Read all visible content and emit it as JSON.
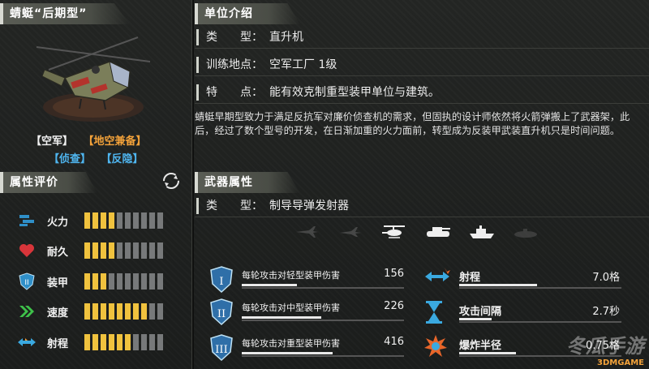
{
  "unit": {
    "name": "蜻蜓“后期型”",
    "tags_row1": [
      {
        "label": "【空军】",
        "color": "white"
      },
      {
        "label": "【地空兼备】",
        "color": "orange"
      }
    ],
    "tags_row2": [
      {
        "label": "【侦查】",
        "color": "blue"
      },
      {
        "label": "【反隐】",
        "color": "blue"
      }
    ]
  },
  "attributes": {
    "header": "属性评价",
    "items": [
      {
        "name": "火力",
        "icon": "missile-icon",
        "filled": 4,
        "total": 10
      },
      {
        "name": "耐久",
        "icon": "heart-icon",
        "filled": 4,
        "total": 10
      },
      {
        "name": "装甲",
        "icon": "armor-shield-icon",
        "filled": 3,
        "total": 10
      },
      {
        "name": "速度",
        "icon": "speed-chevron-icon",
        "filled": 8,
        "total": 10
      },
      {
        "name": "射程",
        "icon": "range-arrows-icon",
        "filled": 6,
        "total": 10
      }
    ]
  },
  "intro": {
    "header": "单位介绍",
    "type_label": "类　　型：",
    "type_value": "直升机",
    "train_label": "训练地点：",
    "train_value": "空军工厂 1级",
    "feature_label": "特　　点：",
    "feature_value": "能有效克制重型装甲单位与建筑。",
    "description": "蜻蜓早期型致力于满足反抗军对廉价侦查机的需求，但固执的设计师依然将火箭弹搬上了武器架，此后，经过了数个型号的开发，在日渐加重的火力面前，转型成为反装甲武装直升机只是时间问题。"
  },
  "weapon": {
    "header": "武器属性",
    "type_label": "类　　型：",
    "type_value": "制导导弹发射器",
    "target_icons": [
      {
        "name": "fighter-jet-icon",
        "active": false
      },
      {
        "name": "bomber-jet-icon",
        "active": false
      },
      {
        "name": "helicopter-icon",
        "active": true
      },
      {
        "name": "tank-icon",
        "active": true
      },
      {
        "name": "ship-icon",
        "active": true
      },
      {
        "name": "submarine-icon",
        "active": false
      }
    ],
    "damage": [
      {
        "tier": "I",
        "label": "每轮攻击对轻型装甲伤害",
        "value": "156"
      },
      {
        "tier": "II",
        "label": "每轮攻击对中型装甲伤害",
        "value": "226"
      },
      {
        "tier": "III",
        "label": "每轮攻击对重型装甲伤害",
        "value": "416"
      }
    ],
    "stats": [
      {
        "label": "射程",
        "value": "7.0格",
        "icon": "range-burst-icon"
      },
      {
        "label": "攻击间隔",
        "value": "2.7秒",
        "icon": "hourglass-icon"
      },
      {
        "label": "爆炸半径",
        "value": "0.75格",
        "icon": "explosion-icon"
      }
    ]
  },
  "watermark": {
    "brand": "冬瓜手游",
    "site": "3DMGAME"
  },
  "colors": {
    "bar_on": "#f0c23e",
    "bar_off": "#77797a",
    "orange": "#f3a23a",
    "blue": "#4fb6f0",
    "badge_blue": "#2f6fa8"
  }
}
